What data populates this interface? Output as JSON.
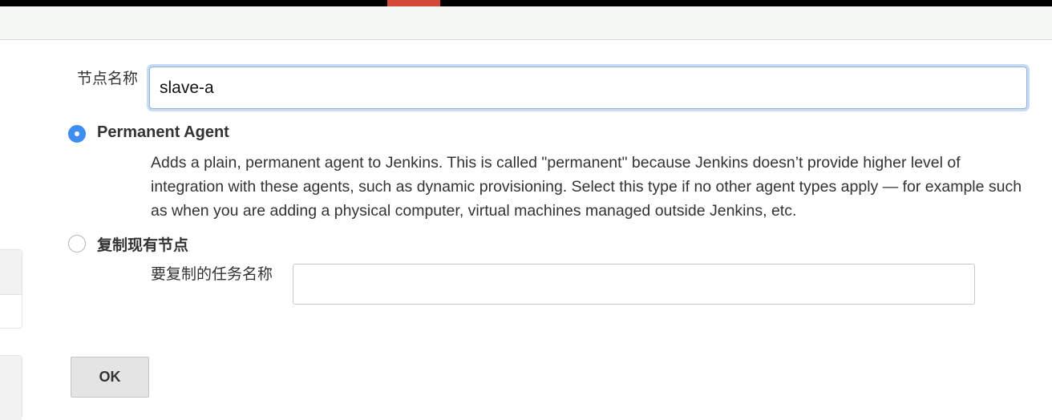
{
  "form": {
    "node_name_label": "节点名称",
    "node_name_value": "slave-a",
    "options": [
      {
        "title": "Permanent Agent",
        "checked": true,
        "description": "Adds a plain, permanent agent to Jenkins. This is called \"permanent\" because Jenkins doesn’t provide higher level of integration with these agents, such as dynamic provisioning. Select this type if no other agent types apply — for example such as when you are adding a physical computer, virtual machines managed outside Jenkins, etc."
      },
      {
        "title": "复制现有节点",
        "checked": false
      }
    ],
    "copy_from_label": "要复制的任务名称",
    "copy_from_value": "",
    "ok_label": "OK"
  },
  "colors": {
    "header_bar": "#000000",
    "header_accent": "#d24939",
    "radio_selected": "#3d8ef0",
    "input_focus_border": "#8fb2e0"
  }
}
